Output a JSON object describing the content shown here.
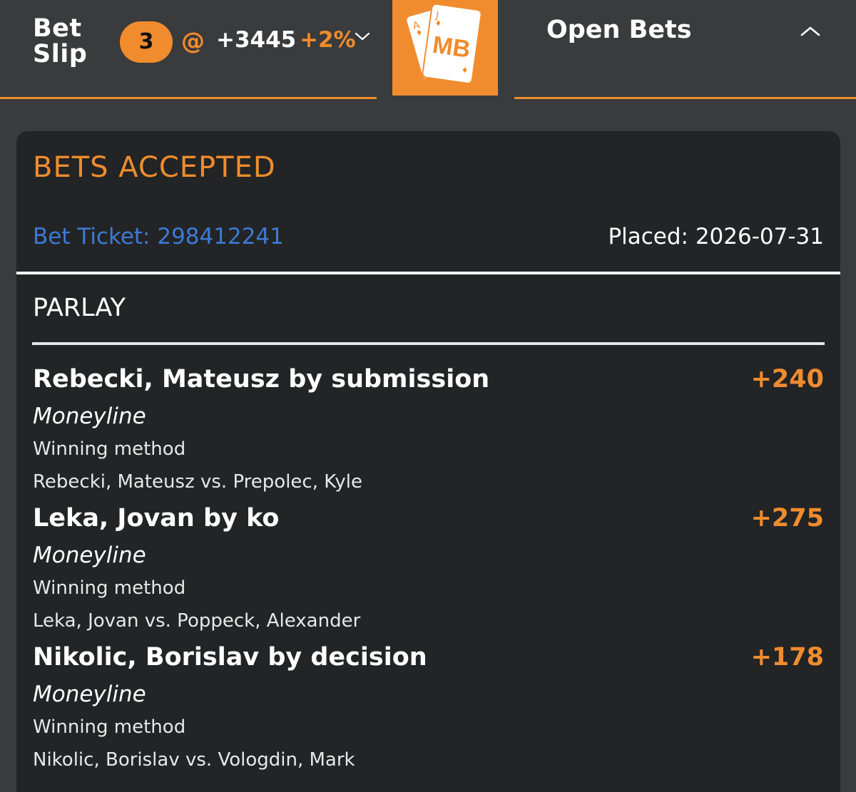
{
  "header": {
    "betslip_line1": "Bet",
    "betslip_line2": "Slip",
    "selection_count": "3",
    "at_symbol": "@",
    "total_odds": "+3445",
    "boost": "+2%",
    "chevron_icon": "chevron-down-icon",
    "logo_text": "MB",
    "logo_card_corners": [
      "A",
      "J"
    ],
    "open_bets_label": "Open Bets",
    "open_bets_icon": "chevron-up-icon"
  },
  "receipt": {
    "status": "BETS ACCEPTED",
    "ticket": "Bet Ticket: 298412241",
    "placed": "Placed: 2026-07-31",
    "bet_type": "PARLAY",
    "legs": [
      {
        "selection": "Rebecki, Mateusz by submission",
        "odds": "+240",
        "market": "Moneyline",
        "type": "Winning method",
        "matchup": "Rebecki, Mateusz vs. Prepolec, Kyle"
      },
      {
        "selection": "Leka, Jovan by ko",
        "odds": "+275",
        "market": "Moneyline",
        "type": "Winning method",
        "matchup": "Leka, Jovan vs. Poppeck, Alexander"
      },
      {
        "selection": "Nikolic, Borislav by decision",
        "odds": "+178",
        "market": "Moneyline",
        "type": "Winning method",
        "matchup": "Nikolic, Borislav vs. Vologdin, Mark"
      }
    ]
  },
  "colors": {
    "accent": "#f08c2e",
    "link": "#3d7ad6",
    "background": "#3a3b3c",
    "card": "#232425",
    "text": "#ffffff"
  }
}
